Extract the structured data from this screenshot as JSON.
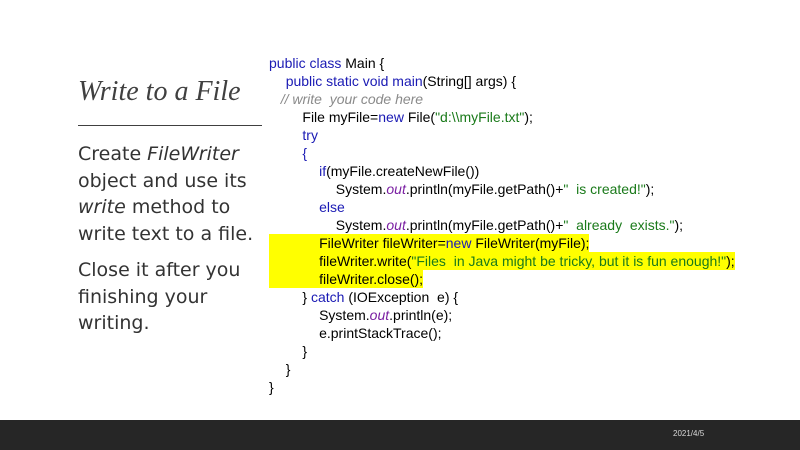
{
  "slide": {
    "title": "Write to a File",
    "paragraph1": {
      "pre": "Create ",
      "em1": "FileWriter",
      "mid": " object and use its ",
      "em2": "write",
      "post": " method to write text to a file."
    },
    "paragraph2": "Close it after you finishing your writing."
  },
  "code": {
    "lines": [
      {
        "indent": 0,
        "highlight": false,
        "tokens": [
          [
            "kw",
            "public class "
          ],
          [
            "",
            "Main {"
          ]
        ]
      },
      {
        "indent": 1,
        "highlight": false,
        "tokens": [
          [
            "kw",
            "public static void main"
          ],
          [
            "",
            "(String[] args) {"
          ]
        ]
      },
      {
        "indent": 0.7,
        "highlight": false,
        "tokens": [
          [
            "cm",
            "// write  your code here"
          ]
        ]
      },
      {
        "indent": 2,
        "highlight": false,
        "tokens": [
          [
            "",
            "File myFile="
          ],
          [
            "kw",
            "new "
          ],
          [
            "",
            "File("
          ],
          [
            "str",
            "\"d:\\\\myFile.txt\""
          ],
          [
            "",
            "); "
          ]
        ]
      },
      {
        "indent": 2,
        "highlight": false,
        "tokens": [
          [
            "kw",
            "try"
          ]
        ]
      },
      {
        "indent": 2,
        "highlight": false,
        "tokens": [
          [
            "kw",
            "{"
          ]
        ]
      },
      {
        "indent": 3,
        "highlight": false,
        "tokens": [
          [
            "kw",
            "if"
          ],
          [
            "",
            "(myFile.createNewFile())"
          ]
        ]
      },
      {
        "indent": 4,
        "highlight": false,
        "tokens": [
          [
            "",
            "System."
          ],
          [
            "out",
            "out"
          ],
          [
            "",
            ".println(myFile.getPath()+"
          ],
          [
            "str",
            "\"  is created!\""
          ],
          [
            "",
            "); "
          ]
        ]
      },
      {
        "indent": 3,
        "highlight": false,
        "tokens": [
          [
            "kw",
            "else"
          ]
        ]
      },
      {
        "indent": 4,
        "highlight": false,
        "tokens": [
          [
            "",
            "System."
          ],
          [
            "out",
            "out"
          ],
          [
            "",
            ".println(myFile.getPath()+"
          ],
          [
            "str",
            "\"  already  exists.\""
          ],
          [
            "",
            "); "
          ]
        ]
      },
      {
        "indent": 3,
        "highlight": true,
        "tokens": [
          [
            "",
            "FileWriter fileWriter="
          ],
          [
            "kw",
            "new "
          ],
          [
            "",
            "FileWriter(myFile);"
          ]
        ]
      },
      {
        "indent": 3,
        "highlight": true,
        "tokens": [
          [
            "",
            "fileWriter.write("
          ],
          [
            "str",
            "\"Files  in Java might be tricky, but it is fun enough!\""
          ],
          [
            "",
            ");"
          ]
        ]
      },
      {
        "indent": 3,
        "highlight": true,
        "tokens": [
          [
            "",
            "fileWriter.close();"
          ]
        ]
      },
      {
        "indent": 2,
        "highlight": false,
        "tokens": [
          [
            "",
            "} "
          ],
          [
            "kw",
            "catch "
          ],
          [
            "",
            "(IOException  e) {"
          ]
        ]
      },
      {
        "indent": 3,
        "highlight": false,
        "tokens": [
          [
            "",
            "System."
          ],
          [
            "out",
            "out"
          ],
          [
            "",
            ".println(e);"
          ]
        ]
      },
      {
        "indent": 3,
        "highlight": false,
        "tokens": [
          [
            "",
            "e.printStackTrace();"
          ]
        ]
      },
      {
        "indent": 2,
        "highlight": false,
        "tokens": [
          [
            "",
            "}"
          ]
        ]
      },
      {
        "indent": 1,
        "highlight": false,
        "tokens": [
          [
            "",
            "}"
          ]
        ]
      },
      {
        "indent": 0,
        "highlight": false,
        "tokens": [
          [
            "",
            "}"
          ]
        ]
      }
    ]
  },
  "footer": {
    "date": "2021/4/5"
  }
}
